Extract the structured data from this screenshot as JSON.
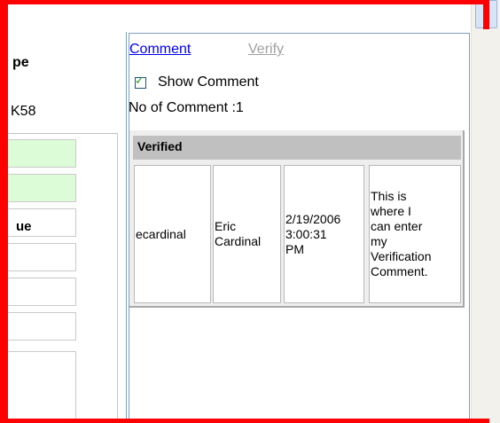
{
  "left_panel": {
    "title_fragment": "pe",
    "id_fragment": "K58",
    "field_label_fragment": "ue"
  },
  "right_panel": {
    "tabs": {
      "comment": "Comment",
      "verify": "Verify"
    },
    "show_comment": {
      "label": "Show Comment",
      "checked": true
    },
    "comment_count_text": "No of Comment :1",
    "verified_table": {
      "header": "Verified",
      "row": {
        "user_id": "ecardinal",
        "user_name": "Eric\nCardinal",
        "timestamp": "2/19/2006\n3:00:31\nPM",
        "comment": "This is\nwhere I\ncan enter\nmy\nVerification\nComment."
      }
    }
  },
  "colors": {
    "highlight_frame": "#ff0000",
    "link": "#0000ee",
    "disabled_link": "#a0a0a0",
    "field_highlight": "#dcfcd8",
    "table_header": "#c0c0c0",
    "panel_border": "#7b9ebd"
  }
}
